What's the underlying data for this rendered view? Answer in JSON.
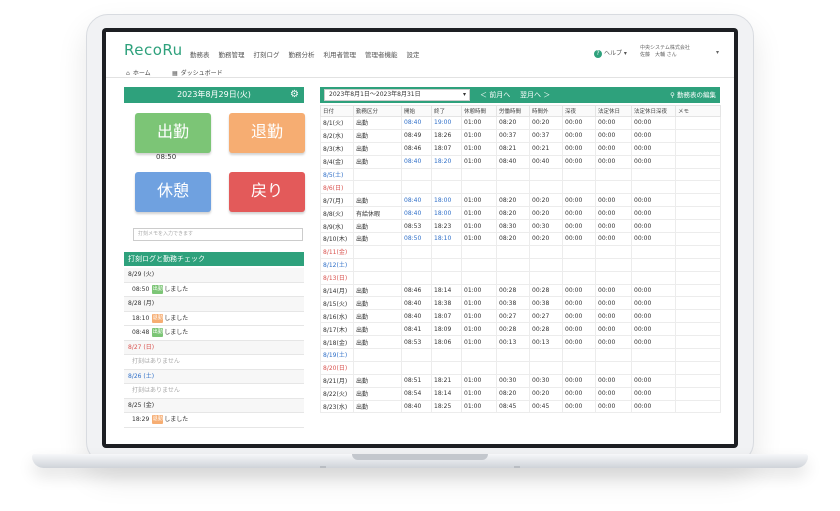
{
  "app": {
    "logo": "RecoRu",
    "accent": "#2ea17c"
  },
  "nav": [
    "勤務表",
    "勤務管理",
    "打刻ログ",
    "勤務分析",
    "利用者管理",
    "管理者機能",
    "設定"
  ],
  "header": {
    "help": "ヘルプ ▾",
    "company": "中央システム株式会社",
    "user": "佐藤　大輔 さん",
    "menu_arrow": "▾"
  },
  "tabs": [
    {
      "icon": "home-icon",
      "label": "ホーム"
    },
    {
      "icon": "dashboard-icon",
      "label": "ダッシュボード"
    }
  ],
  "left": {
    "date_title": "2023年8月29日(火)",
    "buttons": [
      {
        "label": "出勤",
        "color": "#7cc576"
      },
      {
        "label": "退勤",
        "color": "#f6ad72"
      },
      {
        "label": "休憩",
        "color": "#6fa1e0"
      },
      {
        "label": "戻り",
        "color": "#e35a5a"
      }
    ],
    "clock_in_time": "08:50",
    "memo_placeholder": "打刻メモを入力できます",
    "log_title": "打刻ログと勤務チェック",
    "log": [
      {
        "type": "day",
        "text": "8/29 (火)"
      },
      {
        "type": "item",
        "time": "08:50",
        "tag": "出勤",
        "tag_color": "#7cc576",
        "suffix": "しました"
      },
      {
        "type": "day",
        "text": "8/28 (月)"
      },
      {
        "type": "item",
        "time": "18:10",
        "tag": "退勤",
        "tag_color": "#f6ad72",
        "suffix": "しました"
      },
      {
        "type": "item",
        "time": "08:48",
        "tag": "出勤",
        "tag_color": "#7cc576",
        "suffix": "しました"
      },
      {
        "type": "day",
        "text": "8/27 (日)",
        "color": "#d9534f"
      },
      {
        "type": "none",
        "text": "打刻はありません"
      },
      {
        "type": "day",
        "text": "8/26 (土)",
        "color": "#2f6fc8"
      },
      {
        "type": "none",
        "text": "打刻はありません"
      },
      {
        "type": "day",
        "text": "8/25 (金)"
      },
      {
        "type": "item",
        "time": "18:29",
        "tag": "退勤",
        "tag_color": "#f6ad72",
        "suffix": "しました"
      }
    ]
  },
  "right": {
    "range": "2023年8月1日〜2023年8月31日",
    "range_arrow": "▾",
    "prev": "＜ 前月へ",
    "next": "翌月へ ＞",
    "edit": "勤務表の編集",
    "columns": [
      "日付",
      "勤務区分",
      "開始",
      "終了",
      "休憩時間",
      "労働時間",
      "時間外",
      "深夜",
      "法定休日",
      "法定休日深夜",
      "メモ"
    ],
    "rows": [
      {
        "date": "8/1(火)",
        "kind": "出勤",
        "start": "08:40",
        "end": "19:00",
        "brk": "01:00",
        "work": "08:20",
        "ot": "00:20",
        "night": "00:00",
        "hol": "00:00",
        "holn": "00:00",
        "blue": true
      },
      {
        "date": "8/2(水)",
        "kind": "出勤",
        "start": "08:49",
        "end": "18:26",
        "brk": "01:00",
        "work": "00:37",
        "ot": "00:37",
        "night": "00:00",
        "hol": "00:00",
        "holn": "00:00"
      },
      {
        "date": "8/3(木)",
        "kind": "出勤",
        "start": "08:46",
        "end": "18:07",
        "brk": "01:00",
        "work": "08:21",
        "ot": "00:21",
        "night": "00:00",
        "hol": "00:00",
        "holn": "00:00"
      },
      {
        "date": "8/4(金)",
        "kind": "出勤",
        "start": "08:40",
        "end": "18:20",
        "brk": "01:00",
        "work": "08:40",
        "ot": "00:40",
        "night": "00:00",
        "hol": "00:00",
        "holn": "00:00",
        "blue": true
      },
      {
        "date": "8/5(土)",
        "wk": "sat"
      },
      {
        "date": "8/6(日)",
        "wk": "sun"
      },
      {
        "date": "8/7(月)",
        "kind": "出勤",
        "start": "08:40",
        "end": "18:00",
        "brk": "01:00",
        "work": "08:20",
        "ot": "00:20",
        "night": "00:00",
        "hol": "00:00",
        "holn": "00:00",
        "blue": true
      },
      {
        "date": "8/8(火)",
        "kind": "有給休暇",
        "start": "08:40",
        "end": "18:00",
        "brk": "01:00",
        "work": "08:20",
        "ot": "00:20",
        "night": "00:00",
        "hol": "00:00",
        "holn": "00:00",
        "blue": true
      },
      {
        "date": "8/9(水)",
        "kind": "出勤",
        "start": "08:53",
        "end": "18:23",
        "brk": "01:00",
        "work": "08:30",
        "ot": "00:30",
        "night": "00:00",
        "hol": "00:00",
        "holn": "00:00"
      },
      {
        "date": "8/10(木)",
        "kind": "出勤",
        "start": "08:50",
        "end": "18:10",
        "brk": "01:00",
        "work": "08:20",
        "ot": "00:20",
        "night": "00:00",
        "hol": "00:00",
        "holn": "00:00",
        "blue": true
      },
      {
        "date": "8/11(金)",
        "wk": "sun"
      },
      {
        "date": "8/12(土)",
        "wk": "sat"
      },
      {
        "date": "8/13(日)",
        "wk": "sun"
      },
      {
        "date": "8/14(月)",
        "kind": "出勤",
        "start": "08:46",
        "end": "18:14",
        "brk": "01:00",
        "work": "00:28",
        "ot": "00:28",
        "night": "00:00",
        "hol": "00:00",
        "holn": "00:00"
      },
      {
        "date": "8/15(火)",
        "kind": "出勤",
        "start": "08:40",
        "end": "18:38",
        "brk": "01:00",
        "work": "00:38",
        "ot": "00:38",
        "night": "00:00",
        "hol": "00:00",
        "holn": "00:00"
      },
      {
        "date": "8/16(水)",
        "kind": "出勤",
        "start": "08:40",
        "end": "18:07",
        "brk": "01:00",
        "work": "00:27",
        "ot": "00:27",
        "night": "00:00",
        "hol": "00:00",
        "holn": "00:00"
      },
      {
        "date": "8/17(木)",
        "kind": "出勤",
        "start": "08:41",
        "end": "18:09",
        "brk": "01:00",
        "work": "00:28",
        "ot": "00:28",
        "night": "00:00",
        "hol": "00:00",
        "holn": "00:00"
      },
      {
        "date": "8/18(金)",
        "kind": "出勤",
        "start": "08:53",
        "end": "18:06",
        "brk": "01:00",
        "work": "00:13",
        "ot": "00:13",
        "night": "00:00",
        "hol": "00:00",
        "holn": "00:00"
      },
      {
        "date": "8/19(土)",
        "wk": "sat"
      },
      {
        "date": "8/20(日)",
        "wk": "sun"
      },
      {
        "date": "8/21(月)",
        "kind": "出勤",
        "start": "08:51",
        "end": "18:21",
        "brk": "01:00",
        "work": "00:30",
        "ot": "00:30",
        "night": "00:00",
        "hol": "00:00",
        "holn": "00:00"
      },
      {
        "date": "8/22(火)",
        "kind": "出勤",
        "start": "08:54",
        "end": "18:14",
        "brk": "01:00",
        "work": "08:20",
        "ot": "00:20",
        "night": "00:00",
        "hol": "00:00",
        "holn": "00:00"
      },
      {
        "date": "8/23(水)",
        "kind": "出勤",
        "start": "08:40",
        "end": "18:25",
        "brk": "01:00",
        "work": "08:45",
        "ot": "00:45",
        "night": "00:00",
        "hol": "00:00",
        "holn": "00:00"
      }
    ]
  }
}
